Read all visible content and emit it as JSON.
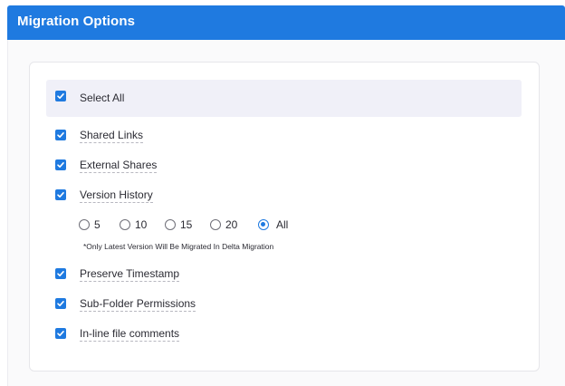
{
  "header": {
    "title": "Migration Options"
  },
  "select_all": {
    "label": "Select All",
    "checked": true
  },
  "options": [
    {
      "label": "Shared Links",
      "checked": true
    },
    {
      "label": "External Shares",
      "checked": true
    },
    {
      "label": "Version History",
      "checked": true
    },
    {
      "label": "Preserve Timestamp",
      "checked": true
    },
    {
      "label": "Sub-Folder Permissions",
      "checked": true
    },
    {
      "label": "In-line file comments",
      "checked": true
    }
  ],
  "version_choices": [
    {
      "label": "5",
      "selected": false
    },
    {
      "label": "10",
      "selected": false
    },
    {
      "label": "15",
      "selected": false
    },
    {
      "label": "20",
      "selected": false
    },
    {
      "label": "All",
      "selected": true
    }
  ],
  "version_note": "*Only Latest Version Will Be Migrated In Delta Migration",
  "colors": {
    "accent": "#1f7ae0",
    "select_all_bg": "#f0f0f8"
  }
}
